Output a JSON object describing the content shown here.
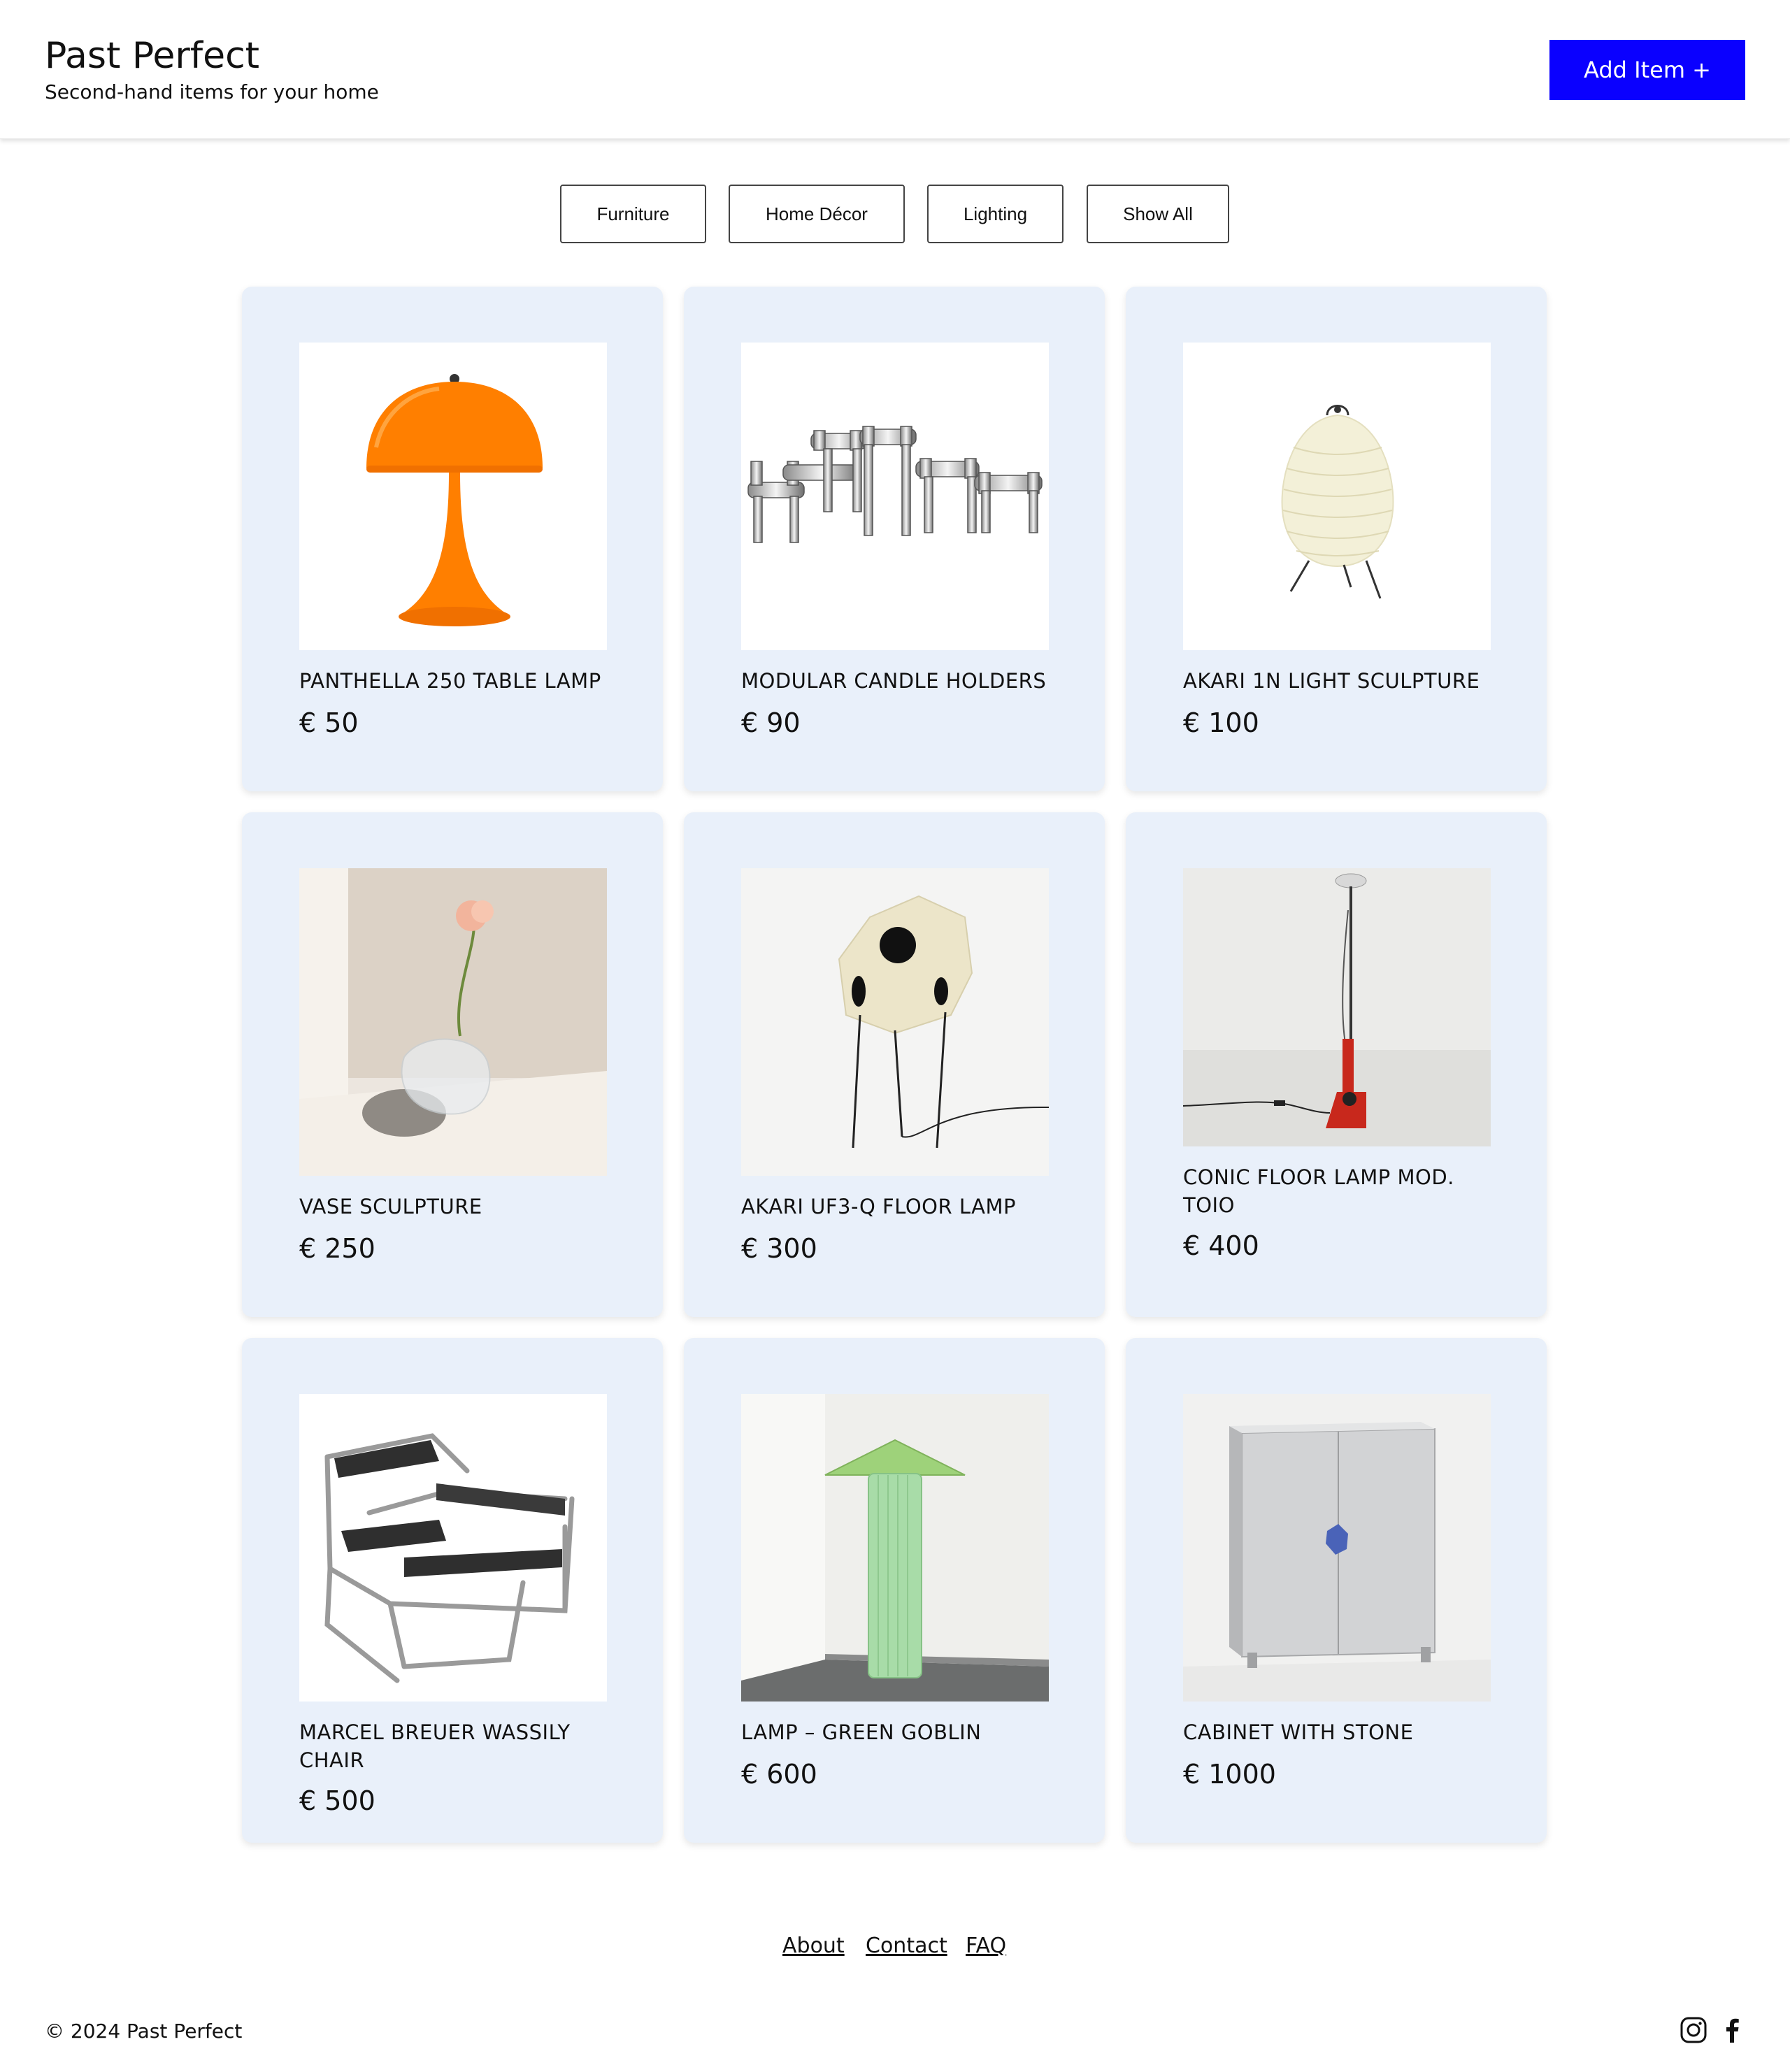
{
  "header": {
    "title": "Past Perfect",
    "subtitle": "Second-hand items for your home",
    "add_button": "Add Item +"
  },
  "filters": [
    "Furniture",
    "Home Décor",
    "Lighting",
    "Show All"
  ],
  "items": [
    {
      "name": "PANTHELLA 250 TABLE LAMP",
      "price": "€ 50",
      "image": "orange-mushroom-lamp"
    },
    {
      "name": "MODULAR CANDLE HOLDERS",
      "price": "€ 90",
      "image": "chrome-candle-holders"
    },
    {
      "name": "AKARI 1N LIGHT SCULPTURE",
      "price": "€ 100",
      "image": "paper-lantern-lamp"
    },
    {
      "name": "VASE SCULPTURE",
      "price": "€ 250",
      "image": "glass-vase-with-flower"
    },
    {
      "name": "AKARI UF3-Q FLOOR LAMP",
      "price": "€ 300",
      "image": "paper-floor-lamp"
    },
    {
      "name": "CONIC FLOOR LAMP MOD. TOIO",
      "price": "€ 400",
      "image": "red-floor-lamp"
    },
    {
      "name": "MARCEL BREUER WASSILY CHAIR",
      "price": "€ 500",
      "image": "steel-leather-chair"
    },
    {
      "name": "LAMP – GREEN GOBLIN",
      "price": "€ 600",
      "image": "green-column-lamp"
    },
    {
      "name": "CABINET WITH STONE",
      "price": "€ 1000",
      "image": "aluminum-cabinet"
    }
  ],
  "footer": {
    "links": [
      "About",
      "Contact",
      "FAQ"
    ],
    "copyright": "© 2024 Past Perfect",
    "social": [
      "instagram-icon",
      "facebook-icon"
    ]
  },
  "colors": {
    "accent": "#0a00ff",
    "card_bg": "#e9f0fa"
  }
}
